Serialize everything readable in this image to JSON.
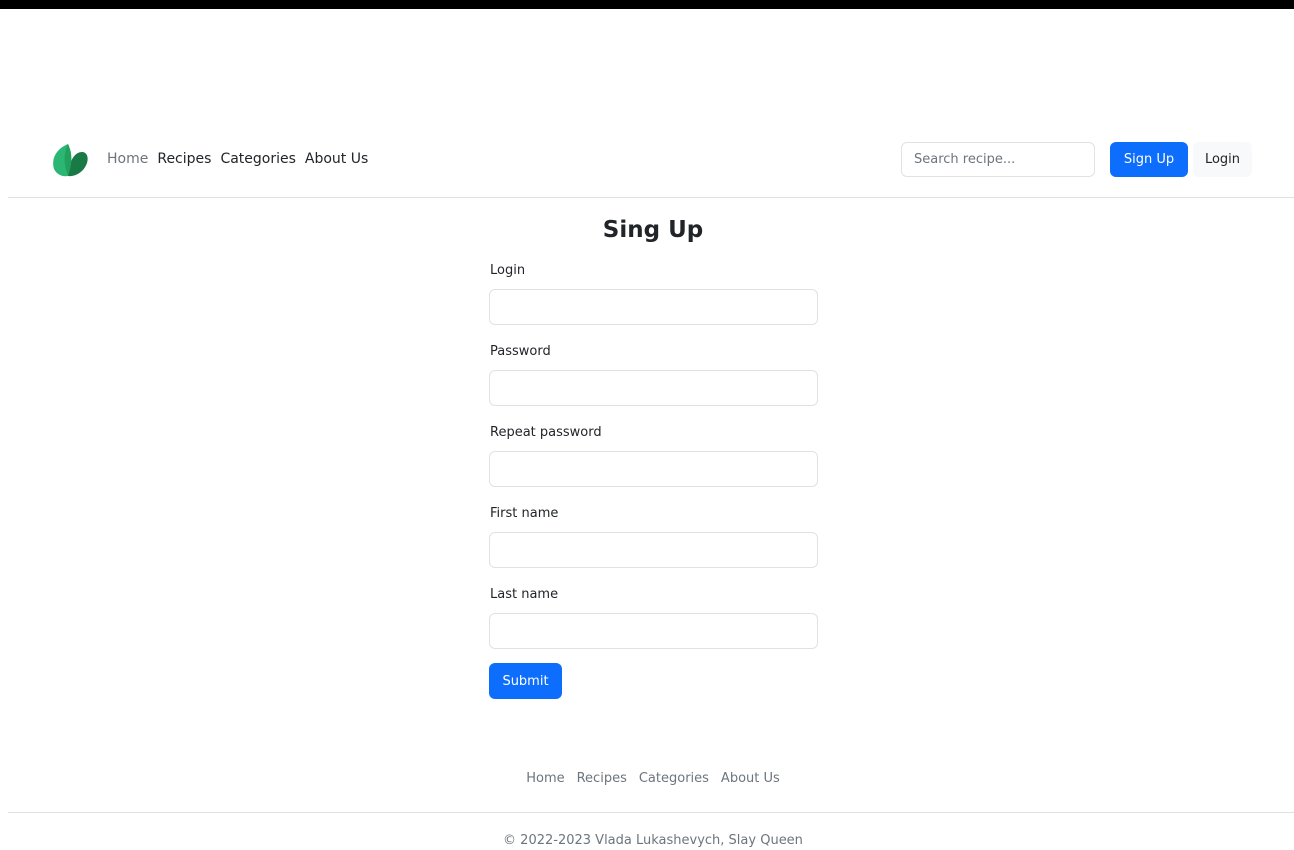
{
  "header": {
    "logo_icon": "leaf-logo-icon",
    "nav": [
      "Home",
      "Recipes",
      "Categories",
      "About Us"
    ],
    "search_placeholder": "Search recipe...",
    "signup_label": "Sign Up",
    "login_label": "Login"
  },
  "form": {
    "title": "Sing Up",
    "fields": [
      {
        "label": "Login"
      },
      {
        "label": "Password"
      },
      {
        "label": "Repeat password"
      },
      {
        "label": "First name"
      },
      {
        "label": "Last name"
      }
    ],
    "submit_label": "Submit"
  },
  "footer": {
    "nav": [
      "Home",
      "Recipes",
      "Categories",
      "About Us"
    ],
    "copyright": "© 2022-2023 Vlada Lukashevych, Slay Queen"
  },
  "colors": {
    "primary": "#0d6efd",
    "logo_light": "#2bb673",
    "logo_dark": "#1a7a45"
  }
}
